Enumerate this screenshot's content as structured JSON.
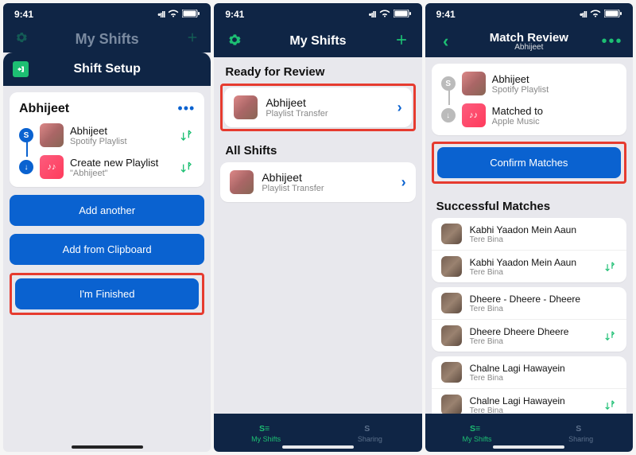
{
  "status": {
    "time": "9:41"
  },
  "screen1": {
    "behind_title": "My Shifts",
    "sheet_title": "Shift Setup",
    "card_title": "Abhijeet",
    "source": {
      "title": "Abhijeet",
      "subtitle": "Spotify Playlist"
    },
    "dest": {
      "title": "Create new Playlist",
      "subtitle": "\"Abhijeet\""
    },
    "btn_add_another": "Add another",
    "btn_add_clipboard": "Add from Clipboard",
    "btn_finished": "I'm Finished"
  },
  "screen2": {
    "title": "My Shifts",
    "section_ready": "Ready for Review",
    "ready_item": {
      "title": "Abhijeet",
      "subtitle": "Playlist Transfer"
    },
    "section_all": "All Shifts",
    "all_item": {
      "title": "Abhijeet",
      "subtitle": "Playlist Transfer"
    },
    "tab_shifts": "My Shifts",
    "tab_sharing": "Sharing"
  },
  "screen3": {
    "title": "Match Review",
    "subtitle": "Abhijeet",
    "source": {
      "title": "Abhijeet",
      "subtitle": "Spotify Playlist"
    },
    "dest": {
      "title": "Matched to",
      "subtitle": "Apple Music"
    },
    "btn_confirm": "Confirm Matches",
    "section_success": "Successful Matches",
    "matches": [
      {
        "title": "Kabhi Yaadon Mein Aaun",
        "artist": "Tere Bina"
      },
      {
        "title": "Kabhi Yaadon Mein Aaun",
        "artist": "Tere Bina"
      },
      {
        "title": "Dheere - Dheere - Dheere",
        "artist": "Tere Bina"
      },
      {
        "title": "Dheere Dheere Dheere",
        "artist": "Tere Bina"
      },
      {
        "title": "Chalne Lagi Hawayein",
        "artist": "Tere Bina"
      },
      {
        "title": "Chalne Lagi Hawayein",
        "artist": "Tere Bina"
      }
    ],
    "tab_shifts": "My Shifts",
    "tab_sharing": "Sharing"
  }
}
